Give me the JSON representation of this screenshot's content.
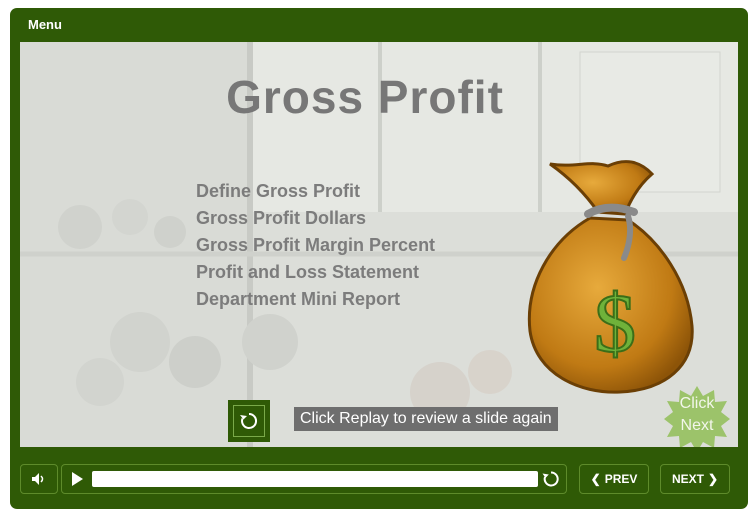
{
  "menu": {
    "label": "Menu"
  },
  "slide": {
    "title": "Gross Profit",
    "topics": [
      "Define Gross Profit",
      "Gross Profit Dollars",
      "Gross Profit Margin Percent",
      "Profit and Loss Statement",
      "Department Mini Report"
    ],
    "bag_symbol": "$",
    "replay_caption": "Click Replay to review a slide again",
    "click_next": [
      "Click",
      "Next"
    ]
  },
  "controls": {
    "prev_label": "PREV",
    "next_label": "NEXT",
    "progress": 0.0
  },
  "colors": {
    "frame": "#2f5a06",
    "bag": "#c8861a",
    "dollar": "#6fb23a",
    "burst": "#9cc36a"
  },
  "icons": [
    "volume-icon",
    "play-icon",
    "replay-icon",
    "chevron-left-icon",
    "chevron-right-icon"
  ]
}
